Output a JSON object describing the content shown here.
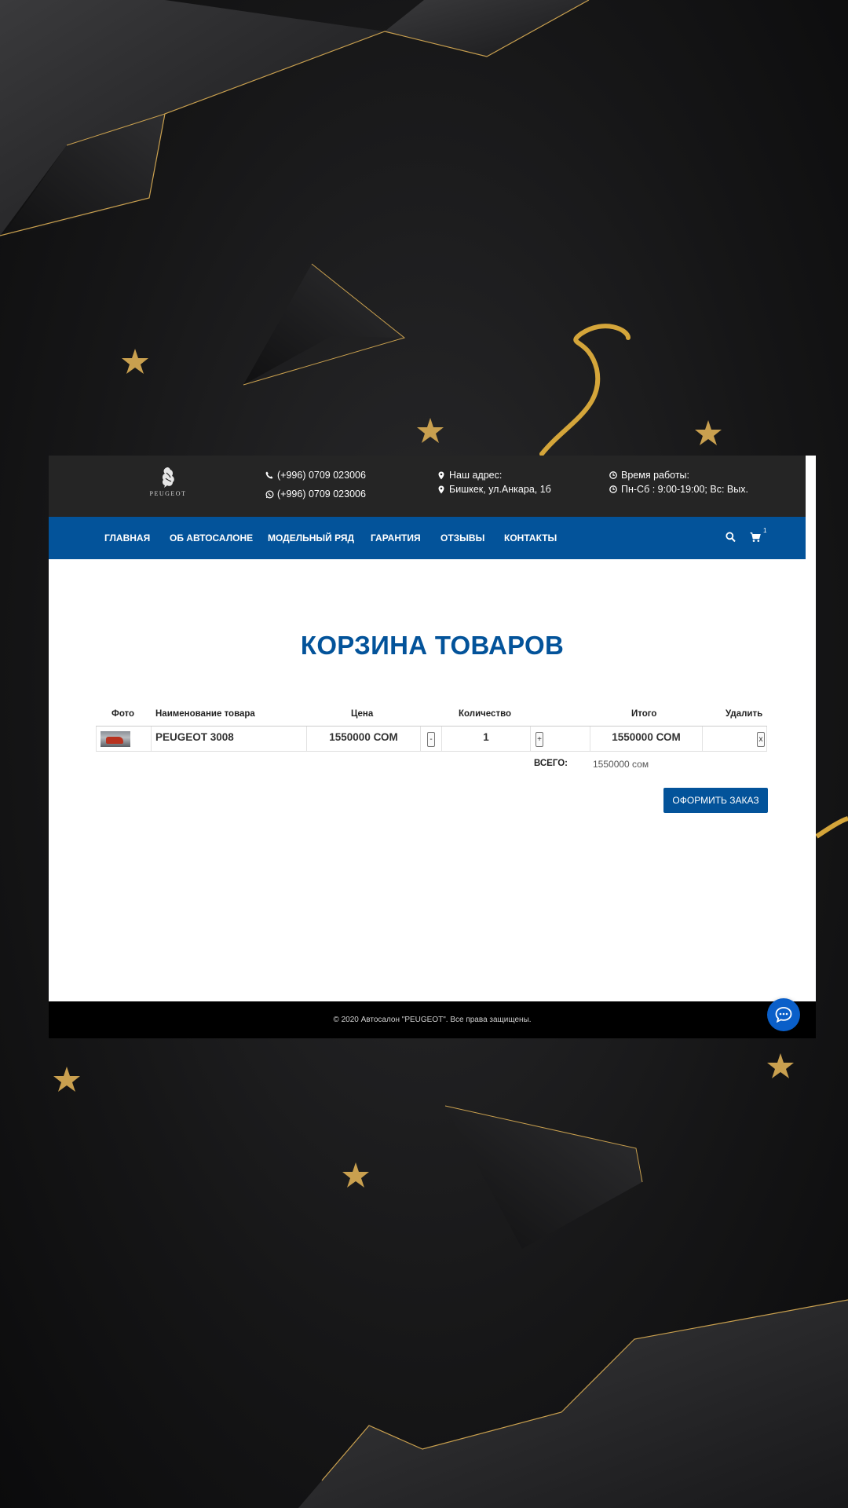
{
  "brand": {
    "logo_text": "PEUGEOT"
  },
  "contacts": {
    "phone": "(+996) 0709 023006",
    "whatsapp": "(+996) 0709 023006",
    "address_label": "Наш адрес:",
    "address": "Бишкек, ул.Анкара, 1б",
    "hours_label": "Время работы:",
    "hours": "Пн-Сб : 9:00-19:00; Вс: Вых."
  },
  "nav": {
    "items": [
      {
        "label": "ГЛАВНАЯ"
      },
      {
        "label": "ОБ АВТОСАЛОНЕ"
      },
      {
        "label": "МОДЕЛЬНЫЙ РЯД"
      },
      {
        "label": "ГАРАНТИЯ"
      },
      {
        "label": "ОТЗЫВЫ"
      },
      {
        "label": "КОНТАКТЫ"
      }
    ],
    "cart_count": "1"
  },
  "page": {
    "title": "КОРЗИНА ТОВАРОВ"
  },
  "cart": {
    "headers": {
      "photo": "Фото",
      "name": "Наименование товара",
      "price": "Цена",
      "qty": "Количество",
      "total": "Итого",
      "remove": "Удалить"
    },
    "items": [
      {
        "name": "PEUGEOT 3008",
        "price": "1550000 СОМ",
        "qty": "1",
        "minus": "-",
        "plus": "+",
        "total": "1550000 СОМ",
        "remove": "x"
      }
    ],
    "total_label": "ВСЕГО:",
    "total_value": "1550000 сом",
    "order_button": "ОФОРМИТЬ ЗАКАЗ"
  },
  "footer": {
    "copyright": "© 2020 Автосалон \"PEUGEOT\". Все права защищены."
  },
  "colors": {
    "accent": "#03539a",
    "gold": "#c9a04f",
    "topbar": "#252525"
  }
}
